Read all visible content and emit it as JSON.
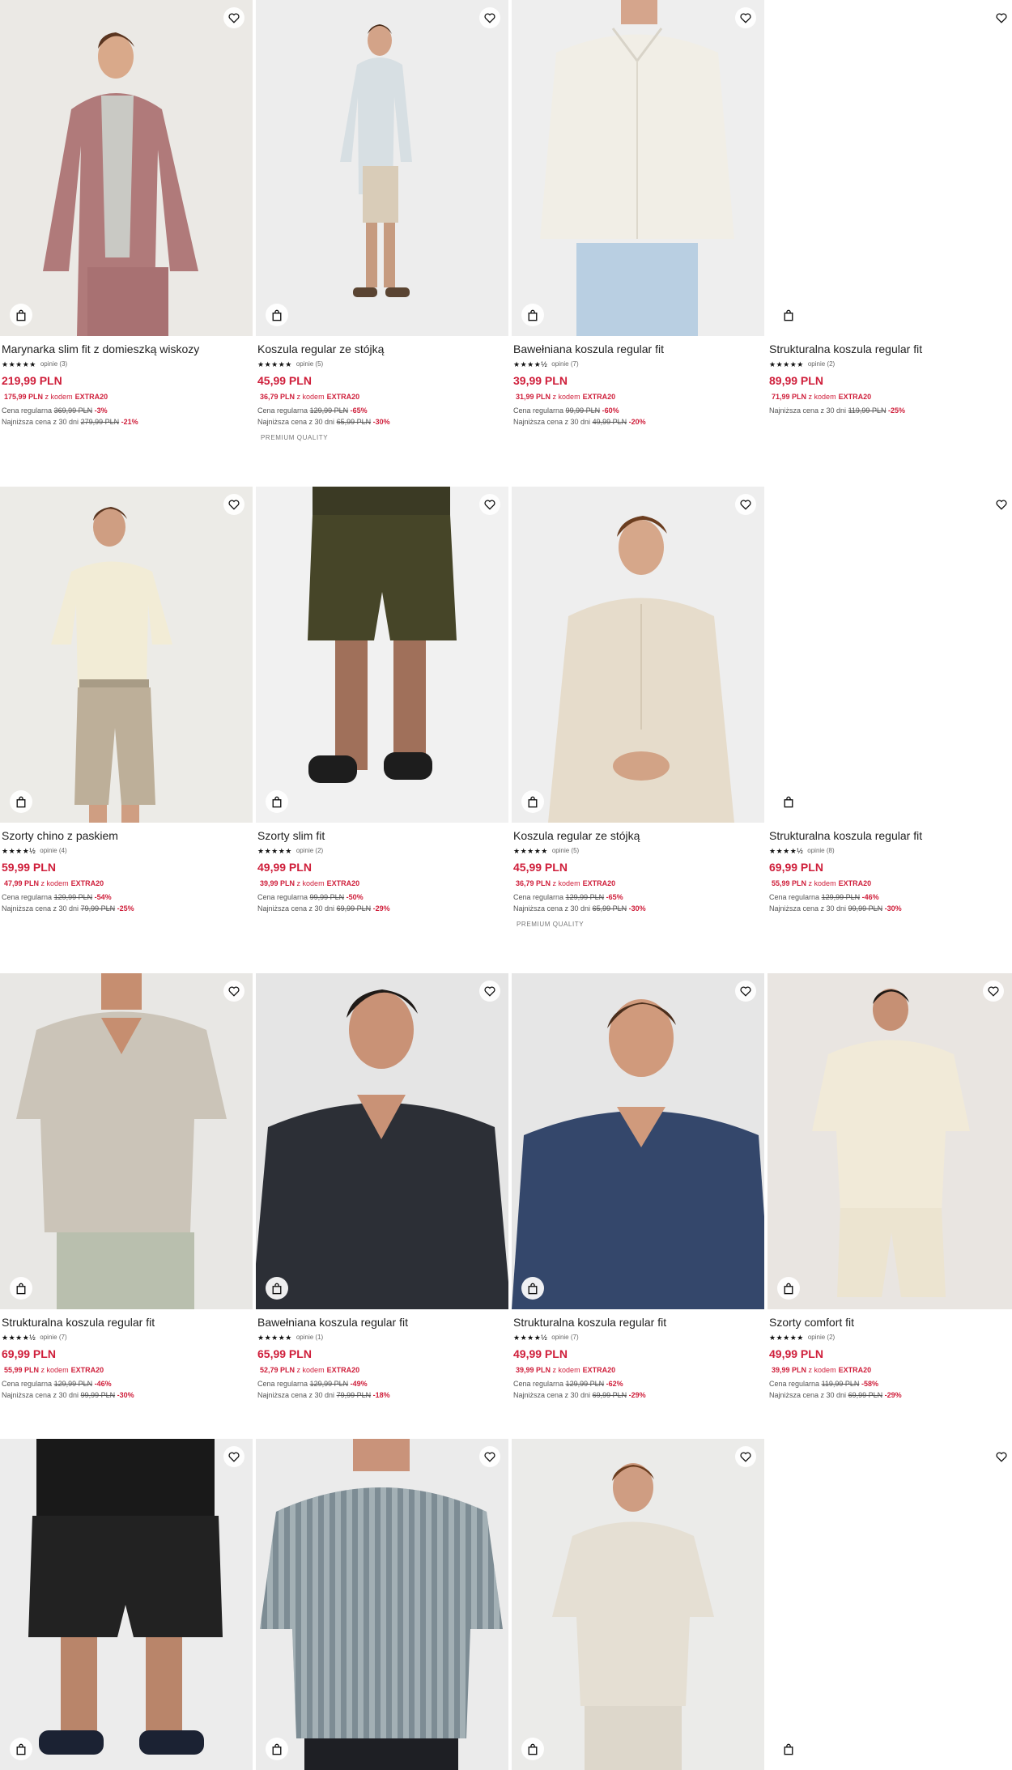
{
  "products": [
    [
      {
        "name": "Marynarka slim fit z domieszką wiskozy",
        "stars": "★★★★★",
        "reviews": "opinie (3)",
        "price": "219,99 PLN",
        "code_price": "175,99 PLN",
        "code_text": "z kodem",
        "code": "EXTRA20",
        "regular_label": "Cena regularna",
        "regular": "369,99 PLN",
        "regular_disc": "-3%",
        "lowest_label": "Najniższa cena z 30 dni",
        "lowest": "279,99 PLN",
        "lowest_disc": "-21%",
        "tag": "",
        "bg": "#e9e7e3"
      },
      {
        "name": "Koszula regular ze stójką",
        "stars": "★★★★★",
        "reviews": "opinie (5)",
        "price": "45,99 PLN",
        "code_price": "36,79 PLN",
        "code_text": "z kodem",
        "code": "EXTRA20",
        "regular_label": "Cena regularna",
        "regular": "129,99 PLN",
        "regular_disc": "-65%",
        "lowest_label": "Najniższa cena z 30 dni",
        "lowest": "65,99 PLN",
        "lowest_disc": "-30%",
        "tag": "PREMIUM QUALITY",
        "bg": "#ececec"
      },
      {
        "name": "Bawełniana koszula regular fit",
        "stars": "★★★★½",
        "reviews": "opinie (7)",
        "price": "39,99 PLN",
        "code_price": "31,99 PLN",
        "code_text": "z kodem",
        "code": "EXTRA20",
        "regular_label": "Cena regularna",
        "regular": "99,99 PLN",
        "regular_disc": "-60%",
        "lowest_label": "Najniższa cena z 30 dni",
        "lowest": "49,99 PLN",
        "lowest_disc": "-20%",
        "tag": "",
        "bg": "#ededed"
      },
      {
        "name": "Strukturalna koszula regular fit",
        "stars": "★★★★★",
        "reviews": "opinie (2)",
        "price": "89,99 PLN",
        "code_price": "71,99 PLN",
        "code_text": "z kodem",
        "code": "EXTRA20",
        "regular_label": "",
        "regular": "",
        "regular_disc": "",
        "lowest_label": "Najniższa cena z 30 dni",
        "lowest": "119,99 PLN",
        "lowest_disc": "-25%",
        "tag": "",
        "bg": "#ffffff"
      }
    ],
    [
      {
        "name": "Szorty chino z paskiem",
        "stars": "★★★★½",
        "reviews": "opinie (4)",
        "price": "59,99 PLN",
        "code_price": "47,99 PLN",
        "code_text": "z kodem",
        "code": "EXTRA20",
        "regular_label": "Cena regularna",
        "regular": "129,99 PLN",
        "regular_disc": "-54%",
        "lowest_label": "Najniższa cena z 30 dni",
        "lowest": "79,99 PLN",
        "lowest_disc": "-25%",
        "tag": "",
        "bg": "#ebeae6"
      },
      {
        "name": "Szorty slim fit",
        "stars": "★★★★★",
        "reviews": "opinie (2)",
        "price": "49,99 PLN",
        "code_price": "39,99 PLN",
        "code_text": "z kodem",
        "code": "EXTRA20",
        "regular_label": "Cena regularna",
        "regular": "99,99 PLN",
        "regular_disc": "-50%",
        "lowest_label": "Najniższa cena z 30 dni",
        "lowest": "69,99 PLN",
        "lowest_disc": "-29%",
        "tag": "",
        "bg": "#f0f0f0"
      },
      {
        "name": "Koszula regular ze stójką",
        "stars": "★★★★★",
        "reviews": "opinie (5)",
        "price": "45,99 PLN",
        "code_price": "36,79 PLN",
        "code_text": "z kodem",
        "code": "EXTRA20",
        "regular_label": "Cena regularna",
        "regular": "129,99 PLN",
        "regular_disc": "-65%",
        "lowest_label": "Najniższa cena z 30 dni",
        "lowest": "65,99 PLN",
        "lowest_disc": "-30%",
        "tag": "PREMIUM QUALITY",
        "bg": "#ececec"
      },
      {
        "name": "Strukturalna koszula regular fit",
        "stars": "★★★★½",
        "reviews": "opinie (8)",
        "price": "69,99 PLN",
        "code_price": "55,99 PLN",
        "code_text": "z kodem",
        "code": "EXTRA20",
        "regular_label": "Cena regularna",
        "regular": "129,99 PLN",
        "regular_disc": "-46%",
        "lowest_label": "Najniższa cena z 30 dni",
        "lowest": "99,99 PLN",
        "lowest_disc": "-30%",
        "tag": "",
        "bg": "#ffffff"
      }
    ],
    [
      {
        "name": "Strukturalna koszula regular fit",
        "stars": "★★★★½",
        "reviews": "opinie (7)",
        "price": "69,99 PLN",
        "code_price": "55,99 PLN",
        "code_text": "z kodem",
        "code": "EXTRA20",
        "regular_label": "Cena regularna",
        "regular": "129,99 PLN",
        "regular_disc": "-46%",
        "lowest_label": "Najniższa cena z 30 dni",
        "lowest": "99,99 PLN",
        "lowest_disc": "-30%",
        "tag": "",
        "bg": "#e6e5e2"
      },
      {
        "name": "Bawełniana koszula regular fit",
        "stars": "★★★★★",
        "reviews": "opinie (1)",
        "price": "65,99 PLN",
        "code_price": "52,79 PLN",
        "code_text": "z kodem",
        "code": "EXTRA20",
        "regular_label": "Cena regularna",
        "regular": "129,99 PLN",
        "regular_disc": "-49%",
        "lowest_label": "Najniższa cena z 30 dni",
        "lowest": "79,99 PLN",
        "lowest_disc": "-18%",
        "tag": "",
        "bg": "#e4e4e4"
      },
      {
        "name": "Strukturalna koszula regular fit",
        "stars": "★★★★½",
        "reviews": "opinie (7)",
        "price": "49,99 PLN",
        "code_price": "39,99 PLN",
        "code_text": "z kodem",
        "code": "EXTRA20",
        "regular_label": "Cena regularna",
        "regular": "129,99 PLN",
        "regular_disc": "-62%",
        "lowest_label": "Najniższa cena z 30 dni",
        "lowest": "69,99 PLN",
        "lowest_disc": "-29%",
        "tag": "",
        "bg": "#e5e5e5"
      },
      {
        "name": "Szorty comfort fit",
        "stars": "★★★★★",
        "reviews": "opinie (2)",
        "price": "49,99 PLN",
        "code_price": "39,99 PLN",
        "code_text": "z kodem",
        "code": "EXTRA20",
        "regular_label": "Cena regularna",
        "regular": "119,99 PLN",
        "regular_disc": "-58%",
        "lowest_label": "Najniższa cena z 30 dni",
        "lowest": "69,99 PLN",
        "lowest_disc": "-29%",
        "tag": "",
        "bg": "#e8e4e0"
      }
    ],
    [
      {
        "name": "",
        "stars": "",
        "reviews": "",
        "price": "",
        "code_price": "",
        "code_text": "",
        "code": "",
        "regular_label": "",
        "regular": "",
        "regular_disc": "",
        "lowest_label": "",
        "lowest": "",
        "lowest_disc": "",
        "tag": "",
        "bg": "#ececec"
      },
      {
        "name": "",
        "stars": "",
        "reviews": "",
        "price": "",
        "code_price": "",
        "code_text": "",
        "code": "",
        "regular_label": "",
        "regular": "",
        "regular_disc": "",
        "lowest_label": "",
        "lowest": "",
        "lowest_disc": "",
        "tag": "",
        "bg": "#e9e9e9"
      },
      {
        "name": "",
        "stars": "",
        "reviews": "",
        "price": "",
        "code_price": "",
        "code_text": "",
        "code": "",
        "regular_label": "",
        "regular": "",
        "regular_disc": "",
        "lowest_label": "",
        "lowest": "",
        "lowest_disc": "",
        "tag": "",
        "bg": "#eaeae8"
      },
      {
        "name": "",
        "stars": "",
        "reviews": "",
        "price": "",
        "code_price": "",
        "code_text": "",
        "code": "",
        "regular_label": "",
        "regular": "",
        "regular_disc": "",
        "lowest_label": "",
        "lowest": "",
        "lowest_disc": "",
        "tag": "",
        "bg": "#ffffff"
      }
    ]
  ],
  "icons": {
    "favorite": "heart-icon",
    "cart": "shopping-bag-icon"
  },
  "colors": {
    "price": "#cf1e3a",
    "text": "#1f1f1f",
    "muted": "#555555"
  }
}
